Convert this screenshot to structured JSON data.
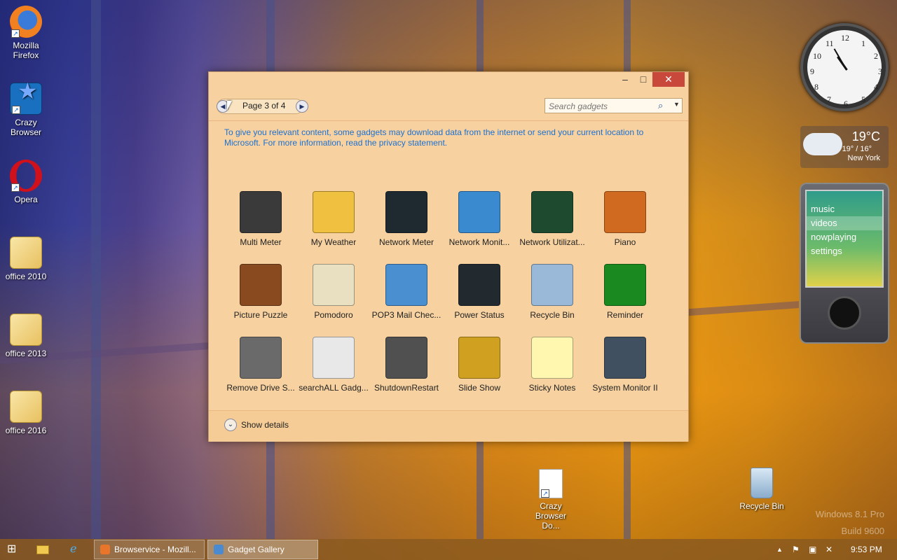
{
  "desktop_icons": [
    {
      "label": "Mozilla Firefox",
      "icon": "firefox-icon"
    },
    {
      "label": "Crazy Browser",
      "icon": "crazy-browser-icon"
    },
    {
      "label": "Opera",
      "icon": "opera-icon"
    },
    {
      "label": "office 2010",
      "icon": "folder-icon"
    },
    {
      "label": "office 2013",
      "icon": "folder-icon"
    },
    {
      "label": "office 2016",
      "icon": "folder-icon"
    },
    {
      "label": "Crazy Browser Do...",
      "icon": "document-icon"
    },
    {
      "label": "Recycle Bin",
      "icon": "recycle-bin-icon"
    }
  ],
  "clock": {
    "numbers": [
      "12",
      "1",
      "2",
      "3",
      "4",
      "5",
      "6",
      "7",
      "8",
      "9",
      "10",
      "11"
    ]
  },
  "weather": {
    "temp": "19°C",
    "range": "19° / 16°",
    "city": "New York"
  },
  "zune": {
    "menu": [
      "music",
      "videos",
      "nowplaying",
      "settings"
    ],
    "selected": "videos"
  },
  "window": {
    "title_buttons": {
      "minimize": "–",
      "maximize": "□",
      "close": "✕"
    },
    "pager_text": "Page 3 of 4",
    "search_placeholder": "Search gadgets",
    "privacy_text": "To give you relevant content, some gadgets may download data from the internet or send your current location to Microsoft. For more information, read the privacy statement.",
    "gadgets": [
      {
        "label": "Multi Meter",
        "color": "#3a3a3a"
      },
      {
        "label": "My Weather",
        "color": "#f0c040"
      },
      {
        "label": "Network Meter",
        "color": "#1e2a30"
      },
      {
        "label": "Network Monit...",
        "color": "#3a8ad0"
      },
      {
        "label": "Network Utilizat...",
        "color": "#1e4a30"
      },
      {
        "label": "Piano",
        "color": "#d06a20"
      },
      {
        "label": "Picture Puzzle",
        "color": "#8a4a20"
      },
      {
        "label": "Pomodoro",
        "color": "#e8e0c0"
      },
      {
        "label": "POP3 Mail Chec...",
        "color": "#4a90d0"
      },
      {
        "label": "Power Status",
        "color": "#222a30"
      },
      {
        "label": "Recycle Bin",
        "color": "#9ab8d8"
      },
      {
        "label": "Reminder",
        "color": "#1a8a20"
      },
      {
        "label": "Remove Drive S...",
        "color": "#6a6a6a"
      },
      {
        "label": "searchALL Gadg...",
        "color": "#e8e8e8"
      },
      {
        "label": "ShutdownRestart",
        "color": "#505050"
      },
      {
        "label": "Slide Show",
        "color": "#d0a020"
      },
      {
        "label": "Sticky Notes",
        "color": "#fff6b0"
      },
      {
        "label": "System Monitor II",
        "color": "#405060"
      }
    ],
    "footer_text": "Show details"
  },
  "taskbar": {
    "tasks": [
      {
        "label": "Browservice - Mozill...",
        "color": "#e8752a"
      },
      {
        "label": "Gadget Gallery",
        "color": "#4a8ad0"
      }
    ],
    "time": "9:53 PM"
  },
  "watermark": {
    "line1": "Windows 8.1 Pro",
    "line2": "Build 9600"
  }
}
